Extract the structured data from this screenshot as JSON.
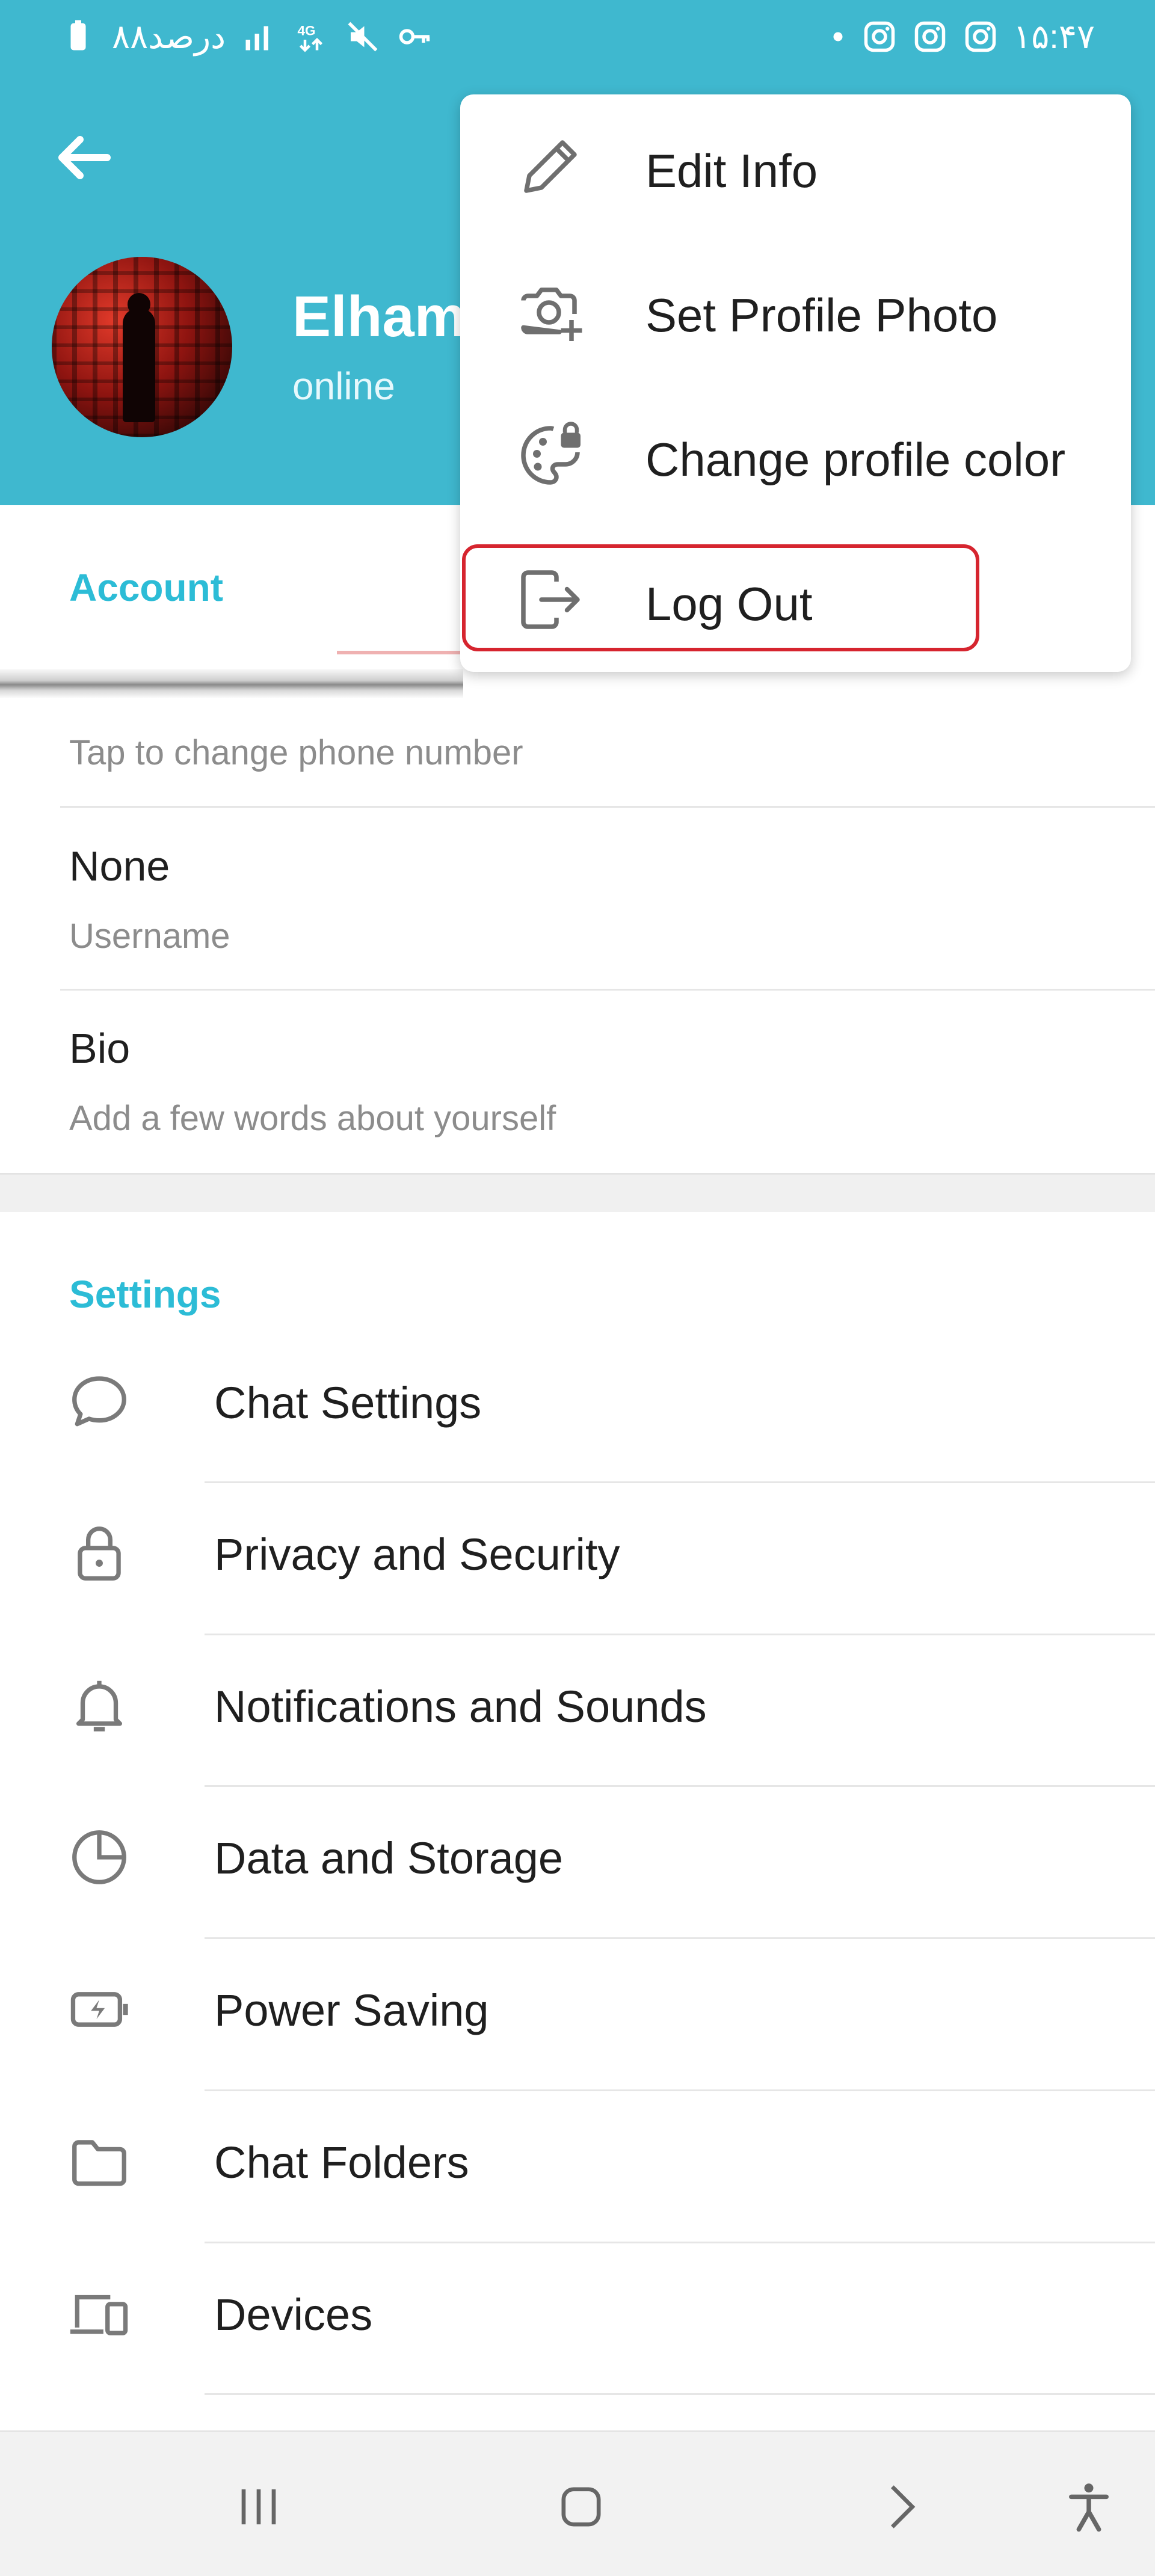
{
  "status_bar": {
    "battery_text": "۸۸درصد",
    "network": "4G",
    "time": "۱۵:۴۷",
    "icons": [
      "battery-icon",
      "signal-icon",
      "network-4g-icon",
      "mute-icon",
      "vpn-key-icon",
      "dot-icon",
      "instagram-icon",
      "instagram-icon",
      "instagram-icon"
    ]
  },
  "header": {
    "name": "Elham",
    "status": "online",
    "back_icon": "arrow-left-icon",
    "background_color": "#3fb8cf"
  },
  "menu": {
    "items": [
      {
        "label": "Edit Info",
        "icon": "pencil-icon"
      },
      {
        "label": "Set Profile Photo",
        "icon": "camera-add-icon"
      },
      {
        "label": "Change profile color",
        "icon": "palette-lock-icon"
      },
      {
        "label": "Log Out",
        "icon": "logout-icon",
        "highlighted": true
      }
    ],
    "highlight_color": "#d6252f"
  },
  "account": {
    "title": "Account",
    "phone_hint": "Tap to change phone number",
    "username_value": "None",
    "username_label": "Username",
    "bio_label": "Bio",
    "bio_hint": "Add a few words about yourself"
  },
  "settings": {
    "title": "Settings",
    "items": [
      {
        "label": "Chat Settings",
        "icon": "chat-bubble-icon"
      },
      {
        "label": "Privacy and Security",
        "icon": "lock-icon"
      },
      {
        "label": "Notifications and Sounds",
        "icon": "bell-icon"
      },
      {
        "label": "Data and Storage",
        "icon": "pie-chart-icon"
      },
      {
        "label": "Power Saving",
        "icon": "battery-bolt-icon"
      },
      {
        "label": "Chat Folders",
        "icon": "folder-icon"
      },
      {
        "label": "Devices",
        "icon": "devices-icon"
      }
    ]
  },
  "nav_bar": {
    "buttons": [
      "recents-icon",
      "home-icon",
      "back-chevron-icon",
      "accessibility-icon"
    ]
  },
  "colors": {
    "accent": "#2cbcd6",
    "header": "#3fb8cf"
  }
}
